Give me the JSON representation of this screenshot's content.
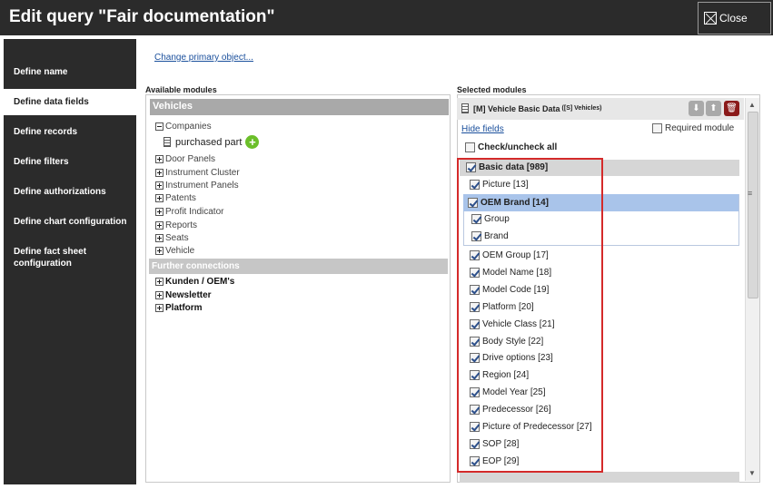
{
  "title": "Edit query \"Fair documentation\"",
  "close_label": "Close",
  "sidebar": {
    "items": [
      {
        "label": "Define name"
      },
      {
        "label": "Define data fields"
      },
      {
        "label": "Define records"
      },
      {
        "label": "Define filters"
      },
      {
        "label": "Define authorizations"
      },
      {
        "label": "Define chart configuration"
      },
      {
        "label": "Define fact sheet configuration"
      }
    ],
    "active_index": 1
  },
  "change_primary_link": "Change primary object...",
  "available": {
    "label": "Available modules",
    "header": "Vehicles",
    "companies": "Companies",
    "purchased_part": "purchased part",
    "items": [
      "Door Panels",
      "Instrument Cluster",
      "Instrument Panels",
      "Patents",
      "Profit Indicator",
      "Reports",
      "Seats",
      "Vehicle"
    ],
    "further_label": "Further connections",
    "further_items": [
      "Kunden / OEM's",
      "Newsletter",
      "Platform"
    ]
  },
  "selected": {
    "label": "Selected modules",
    "module_title": "[M] Vehicle Basic Data",
    "module_sub": "([S] Vehicles)",
    "hide_fields": "Hide fields",
    "required_module": "Required module",
    "check_all": "Check/uncheck all",
    "basic_data": "Basic data [989]",
    "picture": "Picture [13]",
    "oem_brand": "OEM Brand [14]",
    "group": "Group",
    "brand": "Brand",
    "fields": [
      "OEM Group [17]",
      "Model Name [18]",
      "Model Code [19]",
      "Platform [20]",
      "Vehicle Class [21]",
      "Body Style [22]",
      "Drive options [23]",
      "Region [24]",
      "Model Year [25]",
      "Predecessor [26]",
      "Picture of Predecessor [27]",
      "SOP [28]",
      "EOP [29]"
    ]
  },
  "colors": {
    "titlebar": "#2b2b2b",
    "highlight": "#a9c4ea",
    "red_outline": "#d42a2a",
    "add_green": "#6bbf2a"
  }
}
